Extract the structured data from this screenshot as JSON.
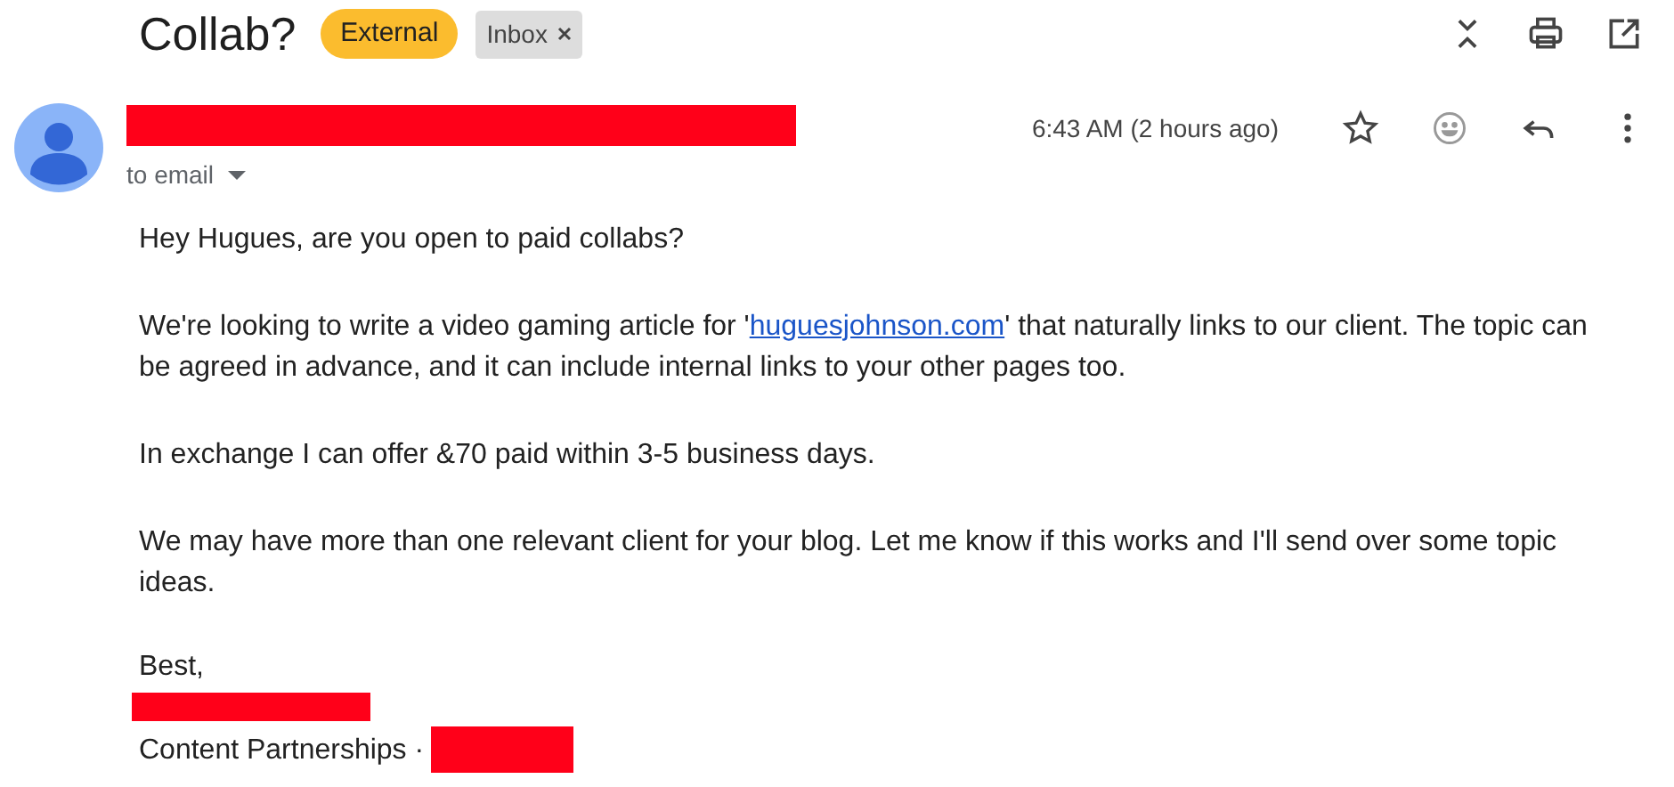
{
  "subject": "Collab?",
  "labels": [
    {
      "text": "External",
      "kind": "warning",
      "removable": false
    },
    {
      "text": "Inbox",
      "kind": "plain",
      "removable": true
    }
  ],
  "sender": {
    "name_redacted": true,
    "to": "to email",
    "time": "6:43 AM (2 hours ago)",
    "starred": false
  },
  "body": [
    {
      "kind": "text",
      "text": "Hey Hugues, are you open to paid collabs?"
    },
    {
      "kind": "link",
      "before": "We're looking to write a video gaming article for '",
      "link": "huguesjohnson.com",
      "after": "' that naturally links to our client. The topic can be agreed in advance, and it can include internal links to your other pages too."
    },
    {
      "kind": "text",
      "text": "In exchange I can offer &70 paid within 3-5 business days."
    },
    {
      "kind": "text",
      "text": "We may have more than one relevant client for your blog. Let me know if this works and I'll send over some topic ideas."
    }
  ],
  "signature": {
    "closing": "Best,",
    "name_redacted": true,
    "title": "Content Partnerships ·",
    "company_redacted": true
  }
}
